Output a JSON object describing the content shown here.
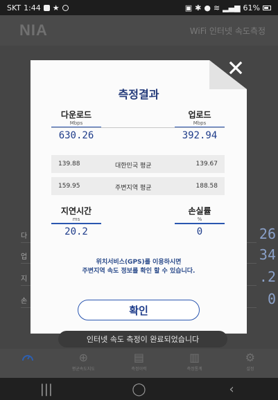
{
  "statusbar": {
    "carrier": "SKT",
    "time": "1:44",
    "battery": "61%"
  },
  "appbar": {
    "logo": "NIA",
    "title": "WiFi 인터넷 속도측정"
  },
  "background_values": [
    {
      "label": "다",
      "value": "26"
    },
    {
      "label": "업",
      "value": "34"
    },
    {
      "label": "지",
      "value": ".2"
    },
    {
      "label": "손",
      "value": "0"
    }
  ],
  "modal": {
    "title": "측정결과",
    "download": {
      "label": "다운로드",
      "unit": "Mbps",
      "value": "630.26"
    },
    "upload": {
      "label": "업로드",
      "unit": "Mbps",
      "value": "392.94"
    },
    "national_avg": {
      "label": "대한민국 평균",
      "left": "139.88",
      "right": "139.67"
    },
    "nearby_avg": {
      "label": "주변지역 평균",
      "left": "159.95",
      "right": "188.58"
    },
    "latency": {
      "label": "지연시간",
      "unit": "ms",
      "value": "20.2"
    },
    "loss": {
      "label": "손실률",
      "unit": "%",
      "value": "0"
    },
    "gps_line1": "위치서비스(GPS)를 이용하시면",
    "gps_line2": "주변지역 속도 정보를 확인 할 수 있습니다.",
    "confirm": "확인"
  },
  "toast": "인터넷 속도 측정이 완료되었습니다",
  "bottomnav": [
    {
      "label": "",
      "icon": "speedometer-icon"
    },
    {
      "label": "평균속도지도",
      "icon": "globe-icon"
    },
    {
      "label": "측정이력",
      "icon": "document-icon"
    },
    {
      "label": "측정통계",
      "icon": "chart-icon"
    },
    {
      "label": "설정",
      "icon": "gear-icon"
    }
  ],
  "colors": {
    "accent": "#2a56b0",
    "title": "#233a7a"
  }
}
